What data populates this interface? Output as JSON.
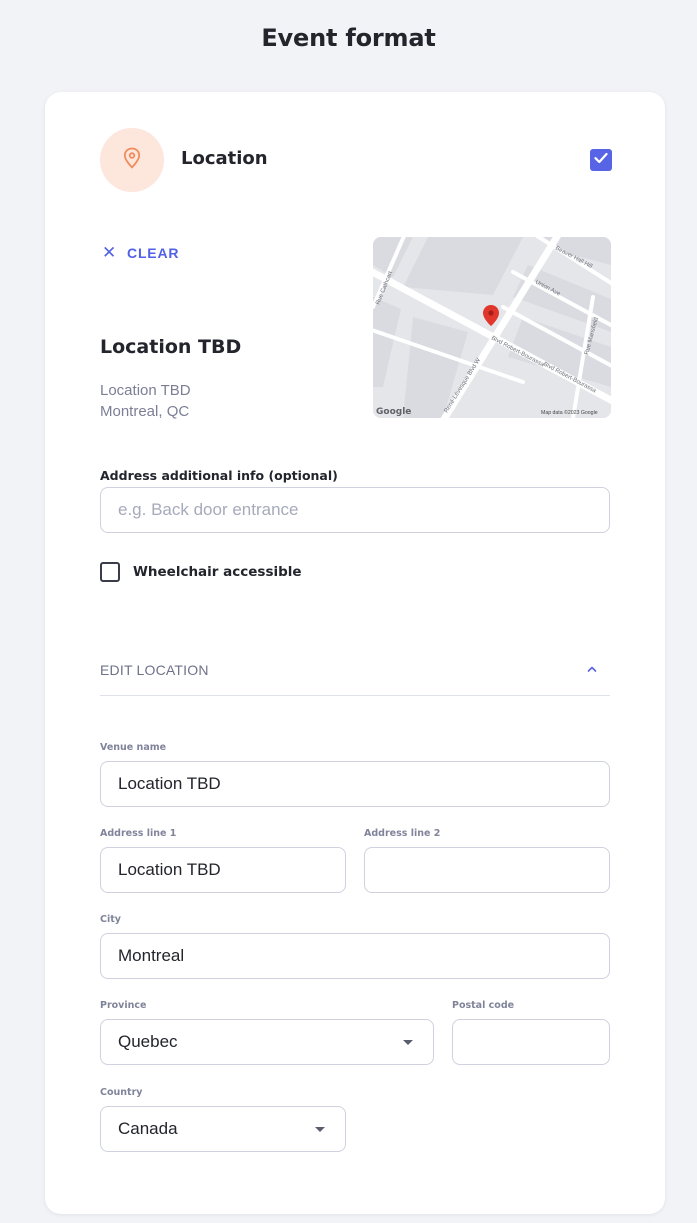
{
  "page": {
    "title": "Event format"
  },
  "location": {
    "title": "Location",
    "checked": true,
    "clear_label": "CLEAR",
    "venue_heading": "Location TBD",
    "address_line_1": "Location TBD",
    "address_line_2": "Montreal, QC",
    "icon": "map-pin-icon",
    "accent_color": "#5864e6",
    "icon_bg_color": "#fde6dc",
    "icon_color": "#f08c5c"
  },
  "map": {
    "streets": [
      "Rue Cathcart",
      "Beaver Hall Hill",
      "Union Ave",
      "Blvd Robert-Bourassa",
      "Blvd Robert-Bourassa",
      "René-Lévesque Blvd W",
      "Rue Mansfield"
    ],
    "logo": "Google",
    "attribution": "Map data ©2023 Google"
  },
  "additional_info": {
    "label": "Address additional info (optional)",
    "placeholder": "e.g. Back door entrance",
    "value": ""
  },
  "wheelchair": {
    "label": "Wheelchair accessible",
    "checked": false
  },
  "edit_location": {
    "label": "EDIT LOCATION",
    "expanded": true,
    "fields": {
      "venue_name": {
        "label": "Venue name",
        "value": "Location TBD"
      },
      "address_line_1": {
        "label": "Address line 1",
        "value": "Location TBD"
      },
      "address_line_2": {
        "label": "Address line 2",
        "value": ""
      },
      "city": {
        "label": "City",
        "value": "Montreal"
      },
      "province": {
        "label": "Province",
        "value": "Quebec"
      },
      "postal_code": {
        "label": "Postal code",
        "value": ""
      },
      "country": {
        "label": "Country",
        "value": "Canada"
      }
    }
  }
}
